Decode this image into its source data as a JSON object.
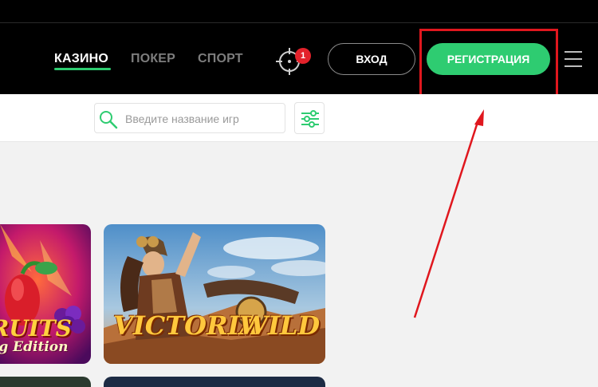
{
  "nav": {
    "items": [
      {
        "label": "КАЗИНО",
        "active": true
      },
      {
        "label": "ПОКЕР",
        "active": false
      },
      {
        "label": "СПОРТ",
        "active": false
      }
    ]
  },
  "notifications": {
    "icon": "crosshair-icon",
    "count": "1"
  },
  "auth": {
    "login_label": "ВХОД",
    "register_label": "РЕГИСТРАЦИЯ"
  },
  "search": {
    "placeholder": "Введите название игр"
  },
  "games": [
    {
      "title_line1": "RUITS",
      "title_line2": "ng Edition"
    },
    {
      "title_word1": "VICTORIA",
      "title_word2": "WILD"
    }
  ],
  "colors": {
    "accent": "#2ecc71",
    "badge": "#e3222b",
    "annotation": "#e0171e",
    "header_bg": "#000000",
    "page_bg": "#f2f2f2"
  }
}
